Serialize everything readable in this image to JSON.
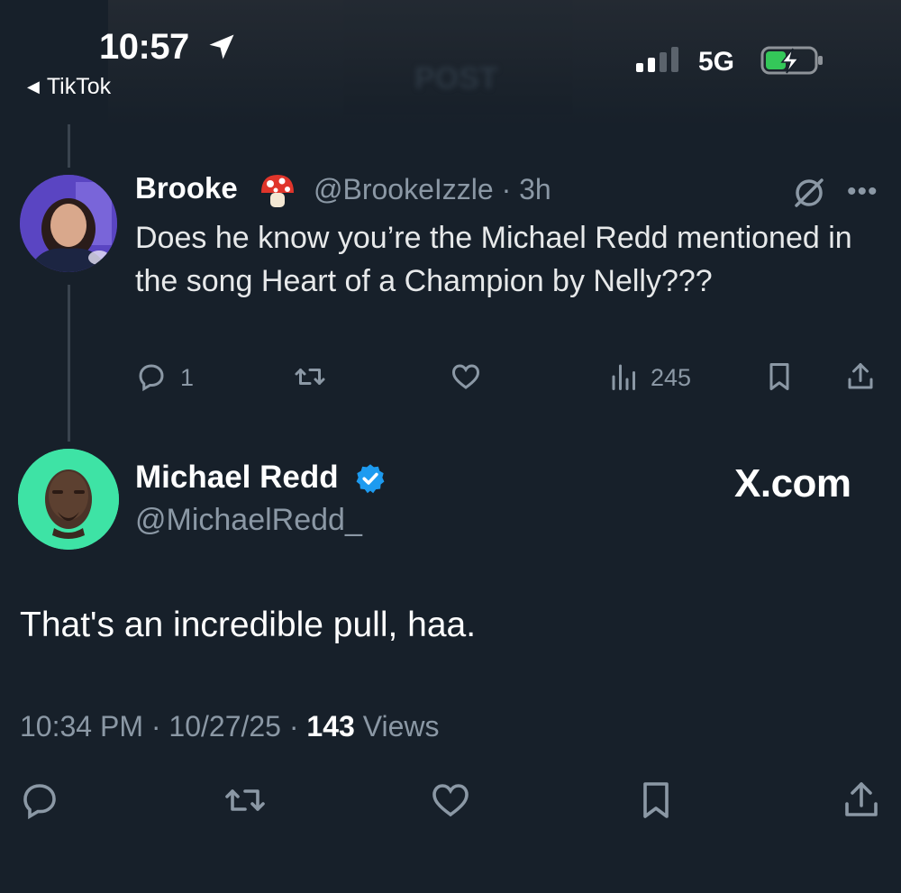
{
  "status_bar": {
    "time": "10:57",
    "back_label": "TikTok",
    "network": "5G"
  },
  "background_banner": {
    "ghost_text": "POST"
  },
  "reply_tweet": {
    "author_name": "Brooke",
    "author_emoji": "mushroom-emoji",
    "handle_time": "@BrookeIzzle · 3h",
    "text": "Does he know you’re the Michael Redd mentioned in the song Heart of a Champion by Nelly???",
    "reply_count": "1",
    "views_count": "245"
  },
  "main_tweet": {
    "author_name": "Michael Redd",
    "handle": "@MichaelRedd_",
    "watermark": "X.com",
    "text": "That's an incredible pull, haa.",
    "timestamp": "10:34 PM · 10/27/25 · ",
    "views_count": "143",
    "views_label": " Views"
  },
  "icons": {
    "reply": "reply-icon",
    "retweet": "retweet-icon",
    "like": "heart-icon",
    "views": "views-icon",
    "bookmark": "bookmark-icon",
    "share": "share-icon",
    "grok": "grok-icon",
    "more": "more-icon",
    "verified": "verified-badge-icon"
  },
  "colors": {
    "background": "#17202a",
    "muted": "#8b98a5",
    "verified": "#1d9bf0",
    "avatar2_bg": "#3ee3a5",
    "battery_green": "#34c759"
  }
}
